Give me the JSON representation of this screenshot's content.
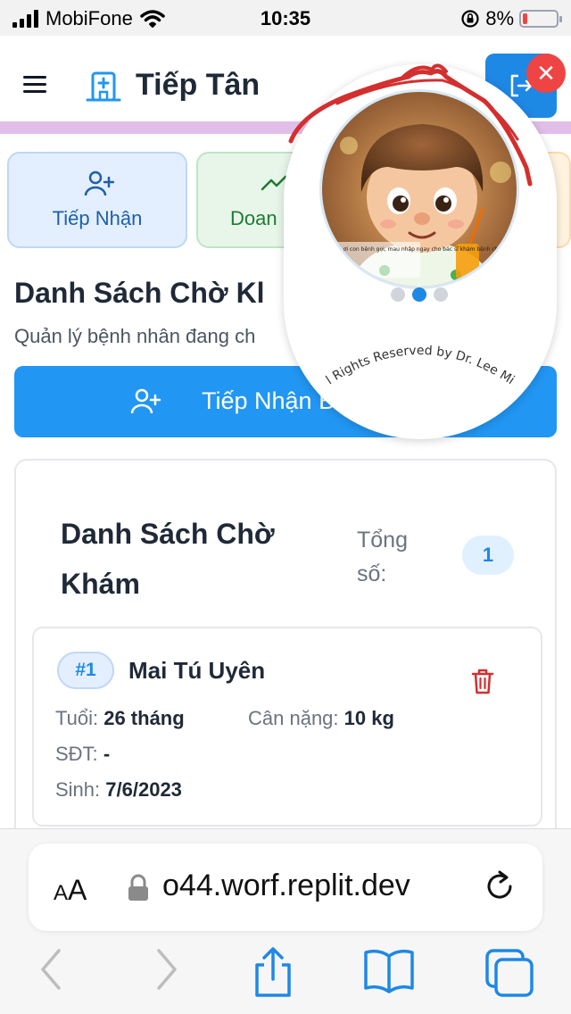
{
  "status_bar": {
    "carrier": "MobiFone",
    "time": "10:35",
    "battery": "8%"
  },
  "header": {
    "title": "Tiếp Tân"
  },
  "tiles": [
    {
      "label": "Tiếp Nhận"
    },
    {
      "label": "Doan"
    }
  ],
  "page": {
    "title": "Danh Sách Chờ Kl",
    "subtitle": "Quản lý bệnh nhân đang ch"
  },
  "register_button": {
    "label": "Tiếp Nhận B"
  },
  "queue": {
    "title": "Danh Sách Chờ Khám",
    "total_label": "Tổng số:",
    "total": "1",
    "patients": [
      {
        "number": "#1",
        "name": "Mai Tú Uyên",
        "age_label": "Tuổi:",
        "age": "26 tháng",
        "weight_label": "Cân nặng:",
        "weight": "10 kg",
        "phone_label": "SĐT:",
        "phone": "-",
        "dob_label": "Sinh:",
        "dob": "7/6/2023"
      }
    ]
  },
  "overlay": {
    "copyright": "l Rights Reserved by Dr. Lee Mi",
    "image_caption": "Bé ơi con bệnh gọi, mau nhập ngay cho bác sĩ khám bệnh cho con",
    "slides": 3,
    "active_slide": 2
  },
  "browser": {
    "text_size": "AA",
    "url": "o44.worf.replit.dev"
  },
  "colors": {
    "primary": "#2196f3",
    "header_strip": "#e1bee7",
    "danger": "#ef4444",
    "scribble": "#d32f2f"
  }
}
